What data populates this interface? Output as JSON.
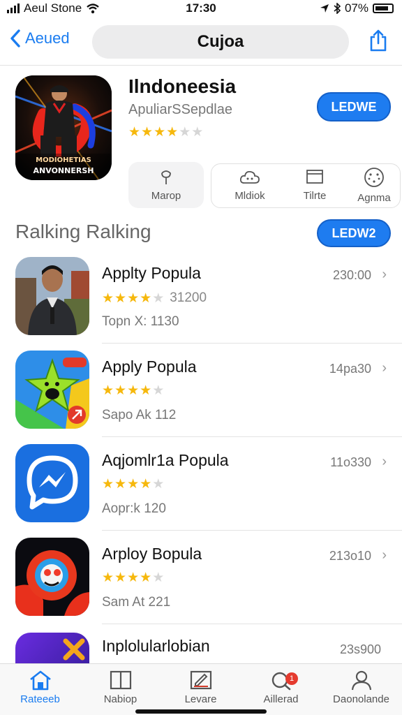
{
  "status_bar": {
    "carrier": "Aeul Stone",
    "time": "17:30",
    "battery": "07%"
  },
  "nav": {
    "back_label": "Aeued",
    "title": "Cujoa"
  },
  "hero": {
    "title": "Ilndoneesia",
    "subtitle": "ApuliarSSepdlae",
    "rating": 3.5,
    "button_label": "LEDWE",
    "icon_text_1": "MODIOHETIAS",
    "icon_text_2": "ANVONNERSH"
  },
  "categories": [
    {
      "label": "Marop",
      "icon": "map-pin-icon"
    },
    {
      "label": "Mldiok",
      "icon": "cloud-icon"
    },
    {
      "label": "Tilrte",
      "icon": "window-icon"
    },
    {
      "label": "Agnma",
      "icon": "face-icon"
    }
  ],
  "section": {
    "title": "Ralking Ralking",
    "button_label": "LEDW2"
  },
  "rows": [
    {
      "title": "Applty Popula",
      "rating": 4,
      "rating_text": "31200",
      "meta": "Topn X: 1130",
      "price": "230:00",
      "icon": "person-photo"
    },
    {
      "title": "Apply Popula",
      "rating": 4,
      "rating_text": "",
      "meta": "Sapo Ak  112",
      "price": "14pa30",
      "icon": "star-monster"
    },
    {
      "title": "Aqjomlr1a Popula",
      "rating": 4,
      "rating_text": "",
      "meta": "Aopr:k  120",
      "price": "11o330",
      "icon": "messenger"
    },
    {
      "title": "Arploy Bopula",
      "rating": 4,
      "rating_text": "",
      "meta": "Sam At  221",
      "price": "213o10",
      "icon": "fish-game"
    },
    {
      "title": "Inplolularlobian",
      "rating": 0,
      "rating_text": "",
      "meta": "",
      "price": "23s900",
      "icon": "purple-x"
    }
  ],
  "tabbar": [
    {
      "label": "Rateeeb",
      "icon": "home-icon",
      "active": true
    },
    {
      "label": "Nabiop",
      "icon": "panel-icon",
      "active": false
    },
    {
      "label": "Levare",
      "icon": "edit-icon",
      "active": false
    },
    {
      "label": "Aillerad",
      "icon": "search-icon",
      "active": false,
      "badge": "1"
    },
    {
      "label": "Daonolande",
      "icon": "person-icon",
      "active": false
    }
  ],
  "colors": {
    "accent": "#1e7cf0",
    "star": "#f6b80d",
    "badge": "#e53b2f"
  }
}
